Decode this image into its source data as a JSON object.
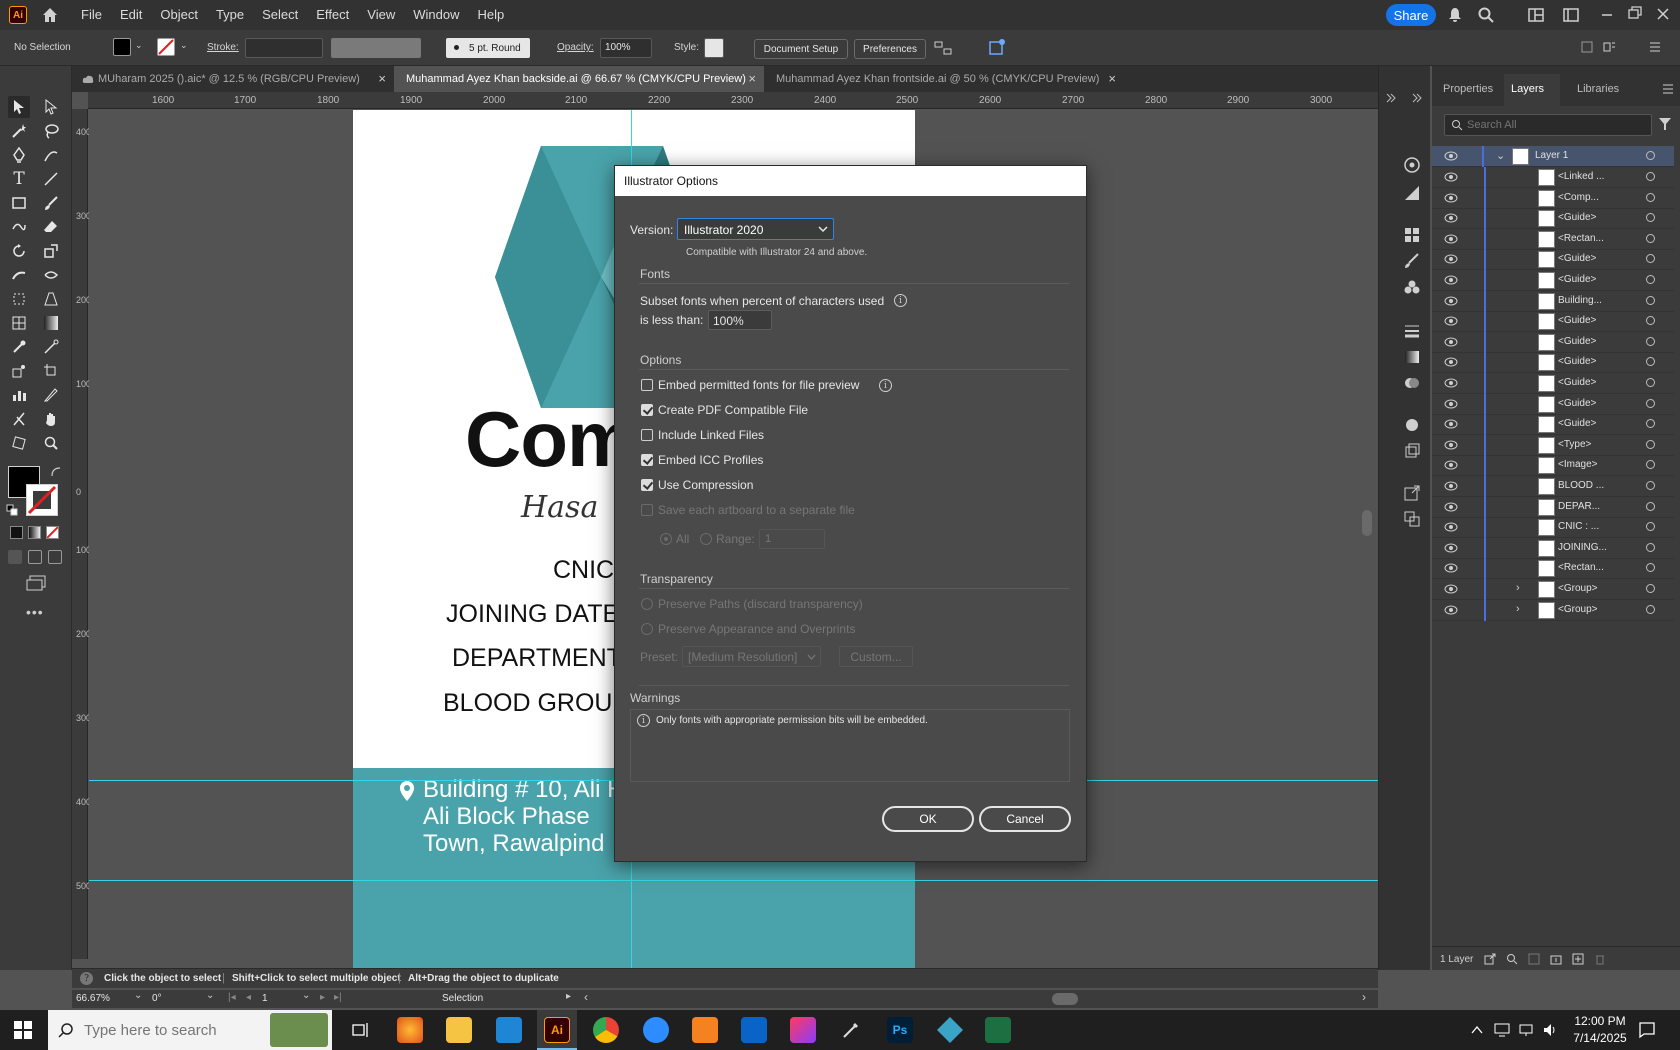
{
  "app": {
    "logo_text": "Ai"
  },
  "menu": [
    "File",
    "Edit",
    "Object",
    "Type",
    "Select",
    "Effect",
    "View",
    "Window",
    "Help"
  ],
  "share_label": "Share",
  "control": {
    "selection": "No Selection",
    "stroke_label": "Stroke:",
    "brush": "5 pt. Round",
    "opacity_label": "Opacity:",
    "opacity_value": "100%",
    "style_label": "Style:",
    "document_setup": "Document Setup",
    "preferences": "Preferences"
  },
  "tabs": [
    {
      "label": "MUharam 2025 ().aic* @ 12.5 % (RGB/CPU Preview)",
      "active": false
    },
    {
      "label": "Muhammad Ayez Khan backside.ai @ 66.67 % (CMYK/CPU Preview)",
      "active": true
    },
    {
      "label": "Muhammad Ayez Khan frontside.ai @ 50 % (CMYK/CPU Preview)",
      "active": false
    }
  ],
  "ruler_top": [
    "1600",
    "1700",
    "1800",
    "1900",
    "2000",
    "2100",
    "2200",
    "2300",
    "2400",
    "2500",
    "2600",
    "2700",
    "2800",
    "2900",
    "3000"
  ],
  "ruler_left": [
    "400",
    "300",
    "200",
    "100",
    "0",
    "100",
    "200",
    "300",
    "400",
    "500"
  ],
  "artboard": {
    "brand_text": "Com",
    "script_text": "Hasa",
    "fields": [
      "CNIC",
      "JOINING DATE",
      "DEPARTMENT",
      "BLOOD GROUP"
    ],
    "address_lines": [
      "Building # 10, Ali H",
      "Ali Block Phase",
      "Town, Rawalpind"
    ]
  },
  "dialog": {
    "title": "Illustrator Options",
    "version_label": "Version:",
    "version_value": "Illustrator 2020",
    "compat_note": "Compatible with Illustrator 24 and above.",
    "fonts_head": "Fonts",
    "subset_line1": "Subset fonts when percent of characters used",
    "subset_line2": "is less than:",
    "subset_value": "100%",
    "options_head": "Options",
    "options": [
      {
        "label": "Embed permitted fonts for file preview",
        "checked": false,
        "disabled": false
      },
      {
        "label": "Create PDF Compatible File",
        "checked": true,
        "disabled": false
      },
      {
        "label": "Include Linked Files",
        "checked": false,
        "disabled": false
      },
      {
        "label": "Embed ICC Profiles",
        "checked": true,
        "disabled": false
      },
      {
        "label": "Use Compression",
        "checked": true,
        "disabled": false
      },
      {
        "label": "Save each artboard to a separate file",
        "checked": false,
        "disabled": true
      }
    ],
    "all_label": "All",
    "range_label": "Range:",
    "range_value": "1",
    "transparency_head": "Transparency",
    "preserve_paths": "Preserve Paths (discard transparency)",
    "preserve_appearance": "Preserve Appearance and Overprints",
    "preset_label": "Preset:",
    "preset_value": "[Medium Resolution]",
    "custom_label": "Custom...",
    "warnings_head": "Warnings",
    "warning_text": "Only fonts with appropriate permission bits will be embedded.",
    "ok": "OK",
    "cancel": "Cancel"
  },
  "panel": {
    "tabs": [
      "Properties",
      "Layers",
      "Libraries"
    ],
    "search_placeholder": "Search All",
    "layer_name": "Layer 1",
    "items": [
      "<Linked ...",
      "<Comp...",
      "<Guide>",
      "<Rectan...",
      "<Guide>",
      "<Guide>",
      "Building...",
      "<Guide>",
      "<Guide>",
      "<Guide>",
      "<Guide>",
      "<Guide>",
      "<Guide>",
      "<Type>",
      "<Image>",
      "BLOOD ...",
      "DEPAR...",
      "CNIC : ...",
      "JOINING...",
      "<Rectan...",
      "<Group>",
      "<Group>"
    ],
    "layers_count": "1 Layer"
  },
  "status": {
    "hint_click": "Click the object to select",
    "hint_shift": "Shift+Click to select multiple object",
    "hint_alt": "Alt+Drag the object to duplicate",
    "zoom": "66.67%",
    "rotation": "0°",
    "artboard_num": "1",
    "tool": "Selection"
  },
  "taskbar": {
    "search_placeholder": "Type here to search",
    "time": "12:00 PM",
    "date": "7/14/2025"
  }
}
